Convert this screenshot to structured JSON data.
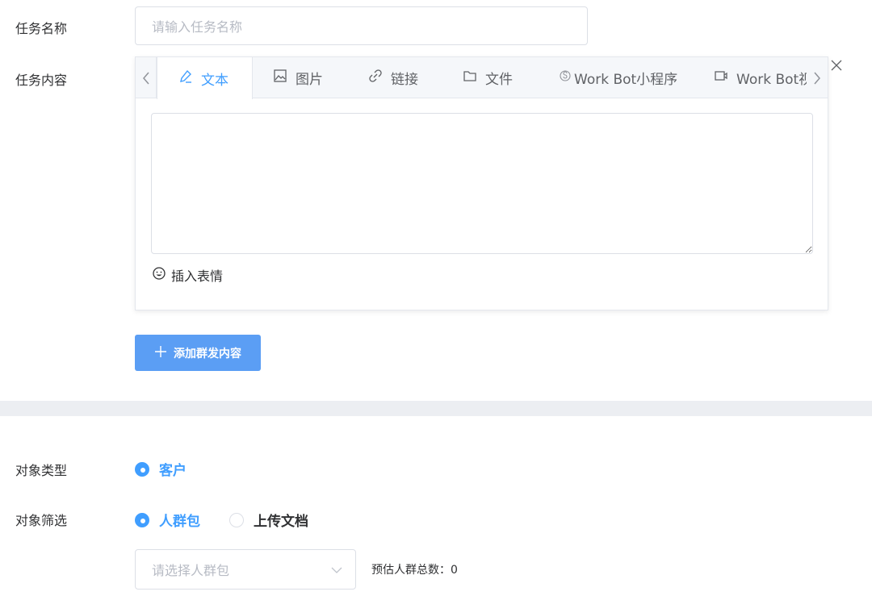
{
  "form": {
    "task_name_label": "任务名称",
    "task_name_placeholder": "请输入任务名称",
    "task_content_label": "任务内容"
  },
  "content_tabs": [
    {
      "label": "文本",
      "icon": "pencil-icon",
      "active": true
    },
    {
      "label": "图片",
      "icon": "image-icon",
      "active": false
    },
    {
      "label": "链接",
      "icon": "link-icon",
      "active": false
    },
    {
      "label": "文件",
      "icon": "folder-icon",
      "active": false
    },
    {
      "label": "Work Bot小程序",
      "icon": "mini-program-icon",
      "active": false
    },
    {
      "label": "Work Bot视",
      "icon": "video-icon",
      "active": false
    }
  ],
  "editor": {
    "content_value": "",
    "emoji_label": "插入表情"
  },
  "add_button": {
    "label": "添加群发内容"
  },
  "target_type": {
    "label": "对象类型",
    "options": [
      {
        "label": "客户",
        "checked": true
      }
    ]
  },
  "target_filter": {
    "label": "对象筛选",
    "options": [
      {
        "label": "人群包",
        "checked": true
      },
      {
        "label": "上传文档",
        "checked": false
      }
    ]
  },
  "crowd_select": {
    "placeholder": "请选择人群包",
    "estimate_text": "预估人群总数：0"
  },
  "colors": {
    "accent": "#409eff",
    "button": "#5b9ef4",
    "border": "#dcdfe6",
    "placeholder": "#b7bbc4"
  }
}
